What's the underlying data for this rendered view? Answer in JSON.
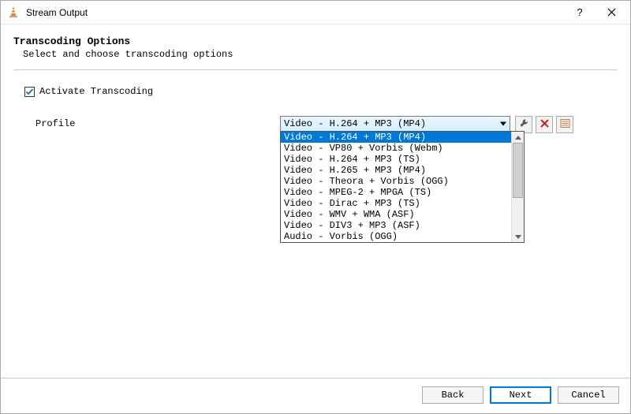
{
  "window": {
    "title": "Stream Output"
  },
  "header": {
    "heading": "Transcoding Options",
    "subheading": "Select and choose transcoding options"
  },
  "activate": {
    "label": "Activate Transcoding",
    "checked": true
  },
  "profile": {
    "label": "Profile",
    "selected": "Video - H.264 + MP3 (MP4)",
    "options": [
      "Video - H.264 + MP3 (MP4)",
      "Video - VP80 + Vorbis (Webm)",
      "Video - H.264 + MP3 (TS)",
      "Video - H.265 + MP3 (MP4)",
      "Video - Theora + Vorbis (OGG)",
      "Video - MPEG-2 + MPGA (TS)",
      "Video - Dirac + MP3 (TS)",
      "Video - WMV + WMA (ASF)",
      "Video - DIV3 + MP3 (ASF)",
      "Audio - Vorbis (OGG)"
    ]
  },
  "footer": {
    "back": "Back",
    "next": "Next",
    "cancel": "Cancel"
  }
}
